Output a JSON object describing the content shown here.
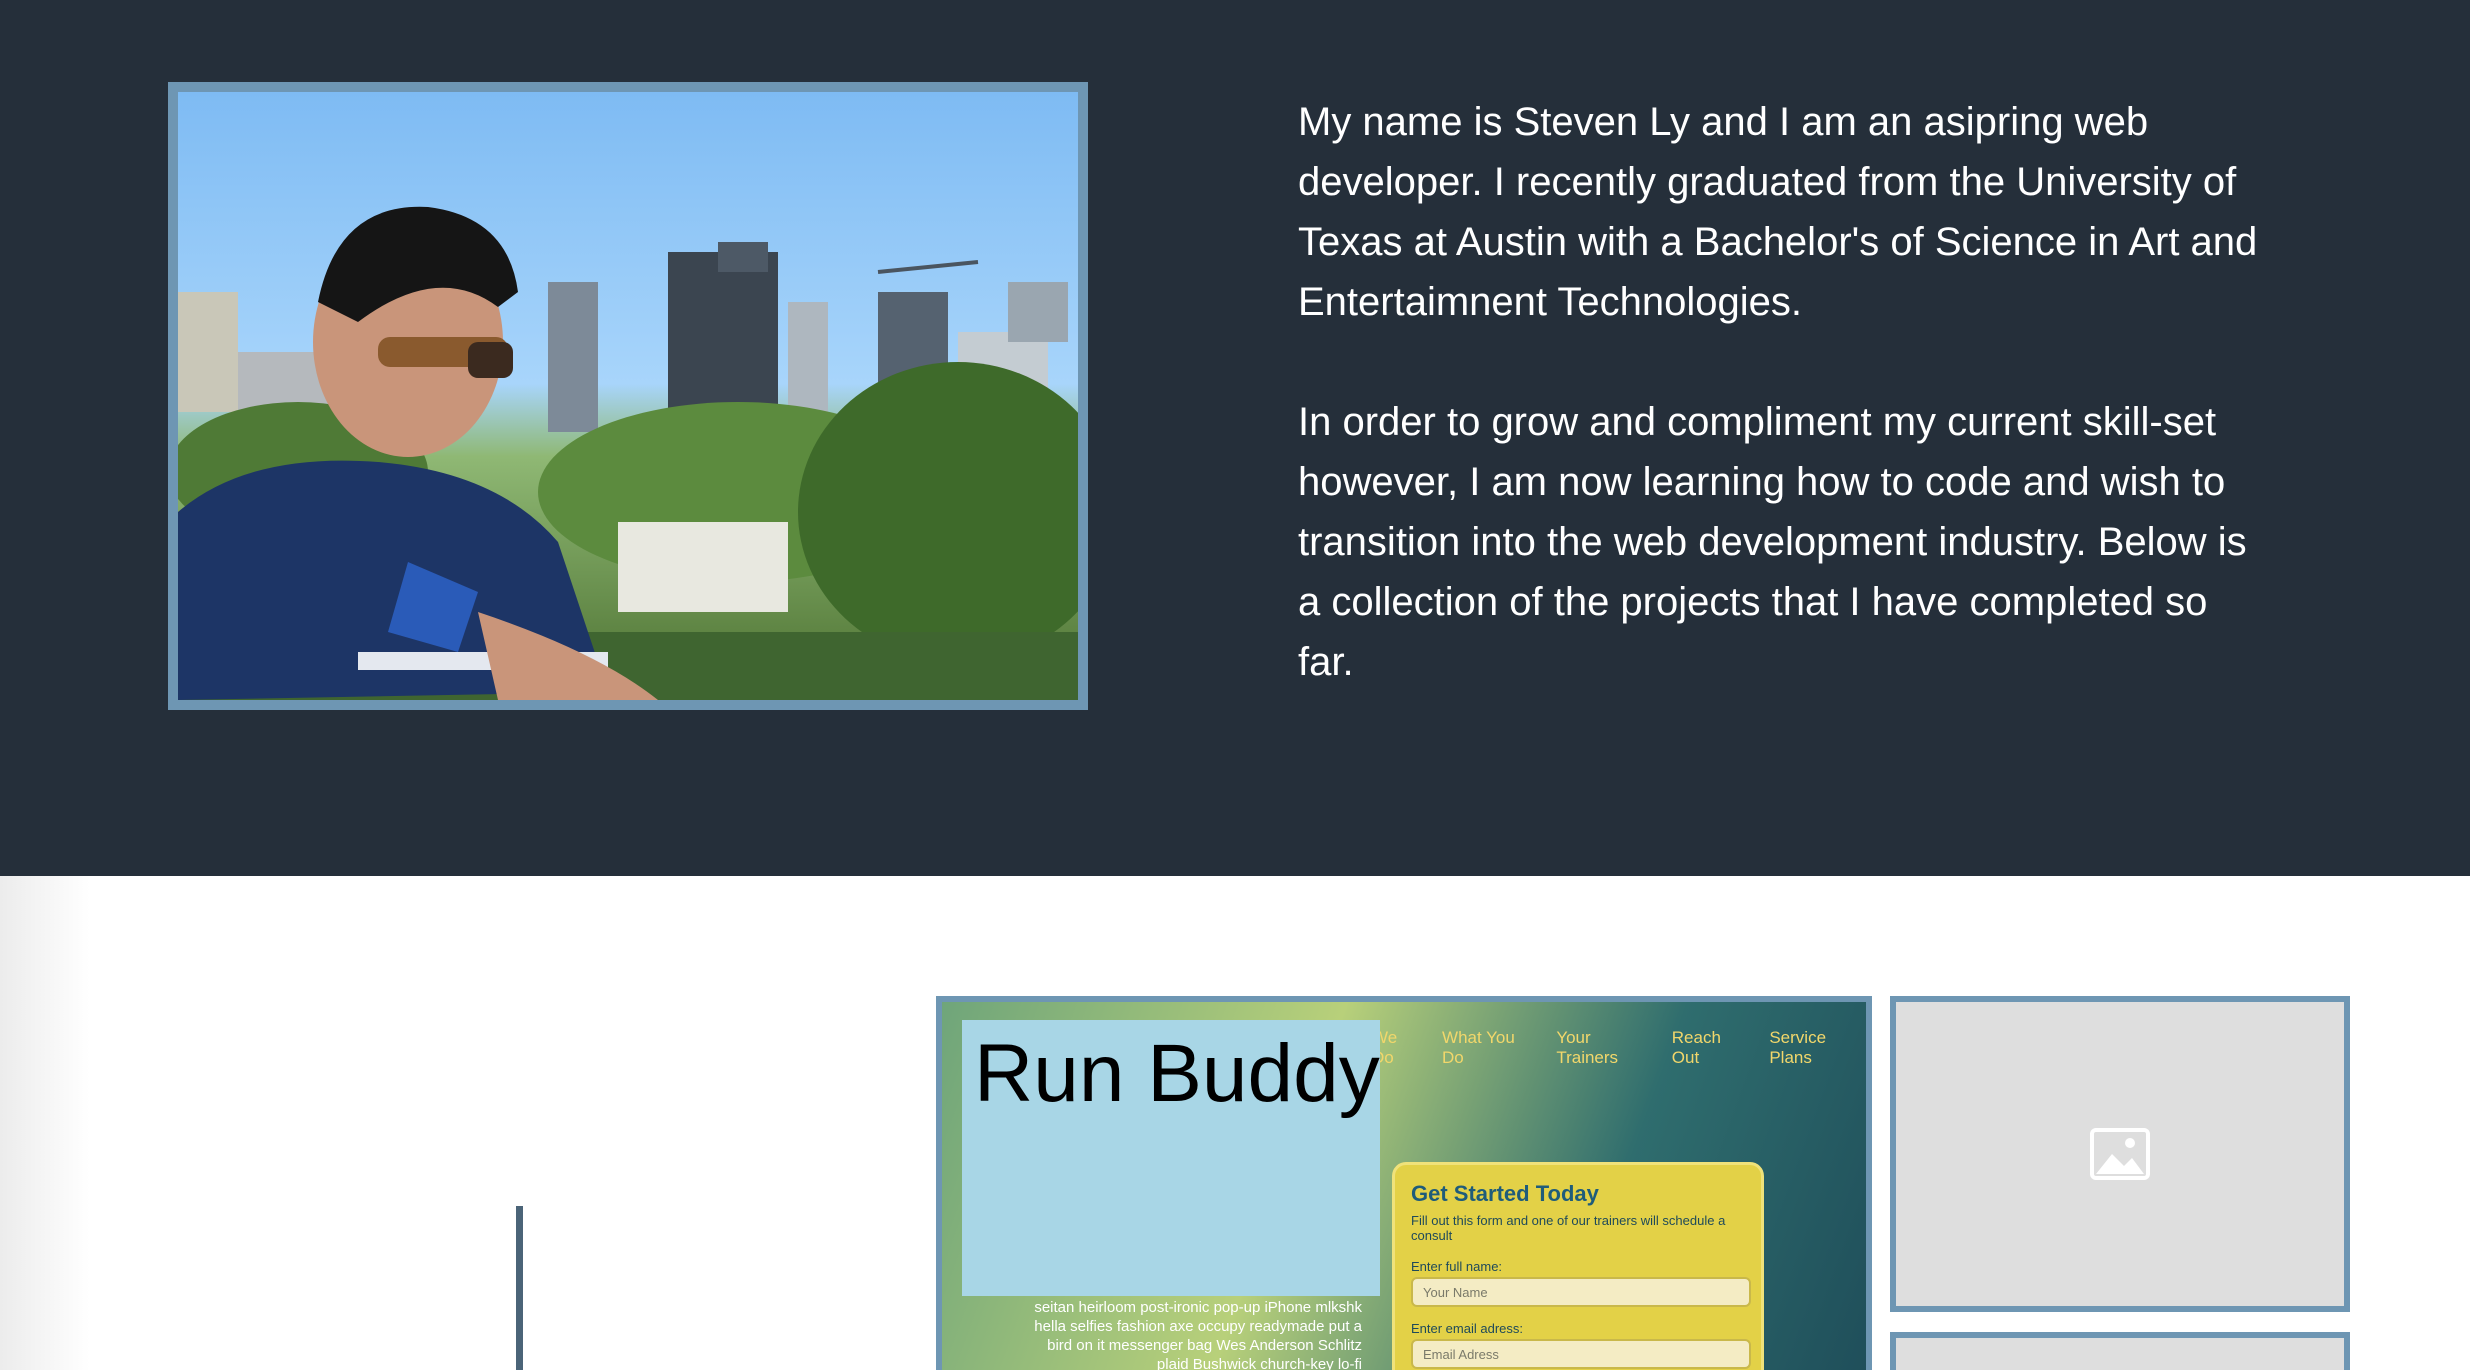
{
  "about": {
    "bio_paragraph_1": "My name is Steven Ly and I am an asipring web developer. I recently graduated from the University of Texas at Austin with a Bachelor's of Science in Art and Entertaimnent Technologies.",
    "bio_paragraph_2": "In order to grow and compliment my current skill-set however, I am now learning how to code and wish to transition into the web development industry. Below is a collection of the projects that I have completed so far."
  },
  "projects": {
    "featured": {
      "title": "Run Buddy",
      "nav": [
        "We Do",
        "What You Do",
        "Your Trainers",
        "Reach Out",
        "Service Plans"
      ],
      "blurb": "seitan heirloom post-ironic pop-up iPhone mlkshk hella selfies fashion axe occupy readymade put a bird on it messenger bag Wes Anderson Schlitz plaid Bushwick church-key lo-fi",
      "form": {
        "heading": "Get Started Today",
        "subheading": "Fill out this form and one of our trainers will schedule a consult",
        "name_label": "Enter full name:",
        "name_placeholder": "Your Name",
        "email_label": "Enter email adress:",
        "email_placeholder": "Email Adress"
      }
    },
    "thumbnail_icon": "image-placeholder-icon"
  },
  "colors": {
    "dark_bg": "#252f3a",
    "frame_blue": "#6e96b3",
    "title_box": "#a8d6e6"
  }
}
